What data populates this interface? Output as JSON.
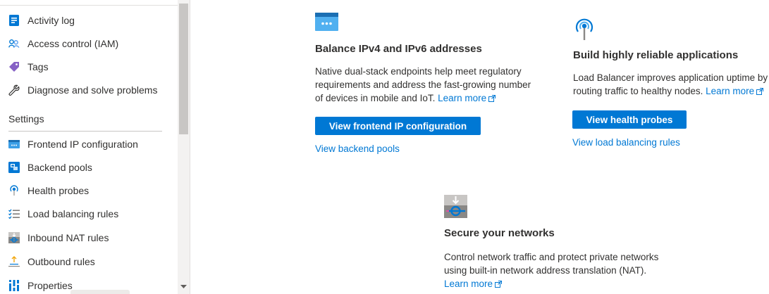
{
  "sidebar": {
    "items_top": [
      {
        "label": "Activity log",
        "icon": "activity-log-icon"
      },
      {
        "label": "Access control (IAM)",
        "icon": "people-icon"
      },
      {
        "label": "Tags",
        "icon": "tag-icon"
      },
      {
        "label": "Diagnose and solve problems",
        "icon": "wrench-icon"
      }
    ],
    "section_header": "Settings",
    "items_settings": [
      {
        "label": "Frontend IP configuration",
        "icon": "frontend-ip-icon"
      },
      {
        "label": "Backend pools",
        "icon": "backend-pools-icon"
      },
      {
        "label": "Health probes",
        "icon": "health-probe-icon"
      },
      {
        "label": "Load balancing rules",
        "icon": "rules-list-icon"
      },
      {
        "label": "Inbound NAT rules",
        "icon": "inbound-nat-icon"
      },
      {
        "label": "Outbound rules",
        "icon": "outbound-rules-icon"
      },
      {
        "label": "Properties",
        "icon": "properties-icon"
      }
    ]
  },
  "cards": {
    "balance": {
      "title": "Balance IPv4 and IPv6 addresses",
      "desc_lines": [
        "Native dual-stack endpoints help meet regulatory",
        "requirements and address the fast-growing number",
        "of devices in mobile and IoT."
      ],
      "learn_more": "Learn more",
      "button": "View frontend IP configuration",
      "link": "View backend pools",
      "icon": "frontend-ip-icon"
    },
    "reliable": {
      "title": "Build highly reliable applications",
      "desc_lines": [
        "Load Balancer improves application uptime by",
        "routing traffic to healthy nodes."
      ],
      "learn_more": "Learn more",
      "button": "View health probes",
      "link": "View load balancing rules",
      "icon": "health-probe-icon"
    },
    "secure": {
      "title": "Secure your networks",
      "desc_lines": [
        "Control network traffic and protect private networks",
        "using built-in network address translation (NAT)."
      ],
      "learn_more": "Learn more",
      "icon": "inbound-nat-icon"
    }
  },
  "colors": {
    "accent": "#0078d4",
    "text": "#323130"
  }
}
